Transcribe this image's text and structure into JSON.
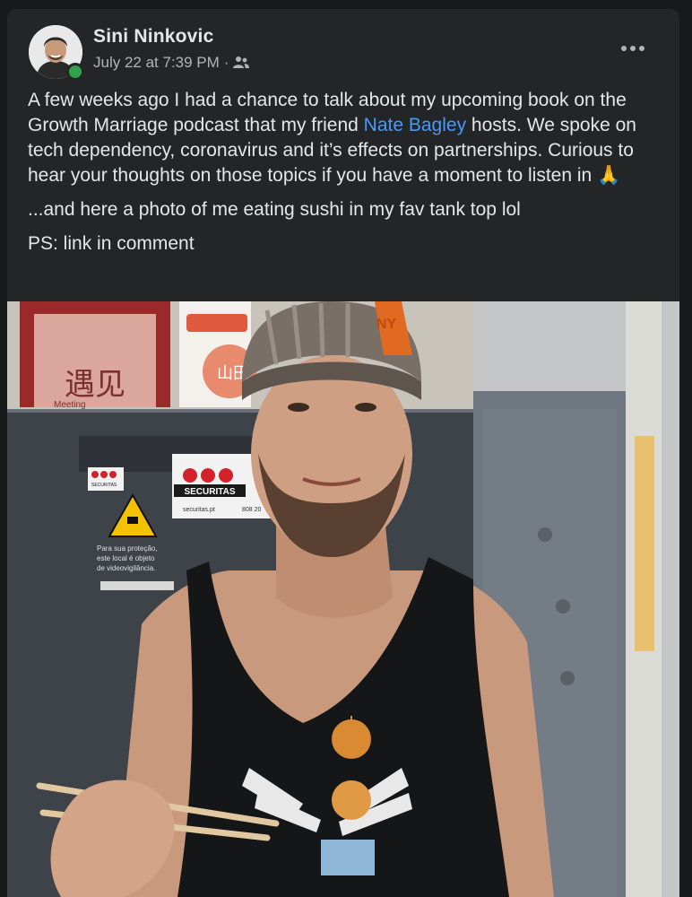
{
  "post": {
    "author": "Sini Ninkovic",
    "timestamp": "July 22 at 7:39 PM",
    "separator": "·",
    "audience_icon": "friends-icon",
    "more_icon": "more-options-icon",
    "text": {
      "p1_before": "A few weeks ago I had a chance to talk about my upcoming book on the Growth Marriage podcast that my friend ",
      "p1_link": "Nate Bagley",
      "p1_after": " hosts. We spoke on tech dependency, coronavirus and it’s effects on partnerships. Curious to hear your thoughts on those topics if you have a moment to listen in ",
      "p1_emoji": "🙏",
      "p2": "...and here a photo of me eating sushi in my fav tank top lol",
      "p3": "PS: link in comment"
    },
    "photo": {
      "signs": {
        "brand_main": "SECURITAS",
        "brand_small": "SECURITAS",
        "website": "securitas.pt",
        "phone": "808 20",
        "warning_line1": "Para sua proteção,",
        "warning_line2": "este local é objeto",
        "warning_line3": "de videovigilância.",
        "poster_chars": "遇见",
        "poster_sub": "Meeting",
        "red_sign": "山田",
        "cap_logo": "NY"
      }
    }
  },
  "colors": {
    "background": "#18191a",
    "card": "#242526",
    "primary_text": "#e4e6eb",
    "secondary_text": "#b0b3b8",
    "link": "#4599ff",
    "online": "#31a24c"
  }
}
